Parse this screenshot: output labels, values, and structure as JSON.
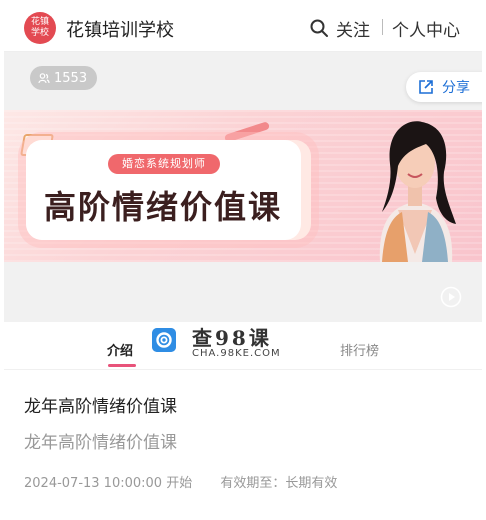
{
  "header": {
    "logo_line1": "花镇",
    "logo_line2": "学校",
    "school_name": "花镇培训学校",
    "follow_label": "关注",
    "center_label": "个人中心"
  },
  "stats": {
    "view_count": "1553"
  },
  "share_label": "分享",
  "banner": {
    "pill_text": "婚恋系统规划师",
    "course_title": "高阶情绪价值课"
  },
  "tabs": [
    {
      "label": "介绍"
    },
    {
      "label": "排行榜"
    }
  ],
  "watermark": {
    "title": "查98课",
    "subtitle": "CHA.98KE.COM"
  },
  "course": {
    "title": "龙年高阶情绪价值课",
    "subtitle": "龙年高阶情绪价值课",
    "start_time": "2024-07-13 10:00:00 开始",
    "validity": "有效期至：长期有效"
  },
  "colors": {
    "logo_red": "#e34a52",
    "share_blue": "#1d6fd6",
    "tab_underline": "#e8537a",
    "pill": "#f0686c"
  },
  "icons": [
    "search-icon",
    "users-icon",
    "share-icon",
    "play-icon",
    "watermark-logo-icon"
  ]
}
